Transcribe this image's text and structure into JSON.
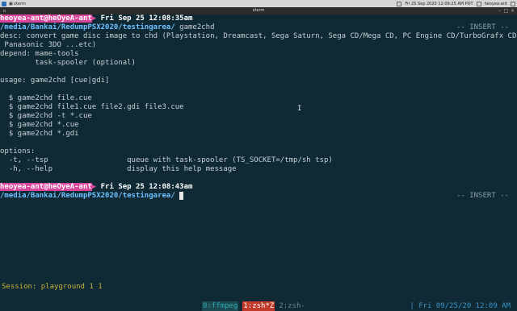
{
  "taskbar": {
    "task_label": "xterm",
    "datetime": "Fri 25 Sep 2020 12:09:25 AM PDT",
    "user_short": "heoyea-ant"
  },
  "window": {
    "title": "xterm"
  },
  "terminal": {
    "prompt1": {
      "user": "heoyea-ant@heOyeA-ant",
      "date": "Fri Sep 25 12:08:35am"
    },
    "path1": "/media/Bankai/RedumpPSX2020/testingarea/",
    "command1": "game2chd",
    "insert_label": "-- INSERT --",
    "output": [
      "desc: convert game disc image to chd (Playstation, Dreamcast, Sega Saturn, Sega CD/Mega CD, PC Engine CD/TurboGrafx CD,",
      " Panasonic 3DO ...etc)",
      "depend: mame-tools",
      "        task-spooler (optional)",
      "",
      "usage: game2chd [cue|gdi]",
      "",
      "  $ game2chd file.cue",
      "  $ game2chd file1.cue file2.gdi file3.cue",
      "  $ game2chd -t *.cue",
      "  $ game2chd *.cue",
      "  $ game2chd *.gdi",
      "",
      "options:",
      "  -t, --tsp                  queue with task-spooler (TS_SOCKET=/tmp/sh tsp)",
      "  -h, --help                 display this help message"
    ],
    "prompt2": {
      "user": "heoyea-ant@heOyeA-ant",
      "date": "Fri Sep 25 12:08:43am"
    },
    "path2": "/media/Bankai/RedumpPSX2020/testingarea/"
  },
  "status": {
    "session": "Session: playground 1 1",
    "windows": [
      {
        "label": "0:ffmpeg",
        "state": "inactive"
      },
      {
        "label": "1:zsh*Z",
        "state": "active"
      },
      {
        "label": "2:zsh-",
        "state": "other"
      }
    ],
    "clock": "| Fri 09/25/20 12:09 AM"
  }
}
